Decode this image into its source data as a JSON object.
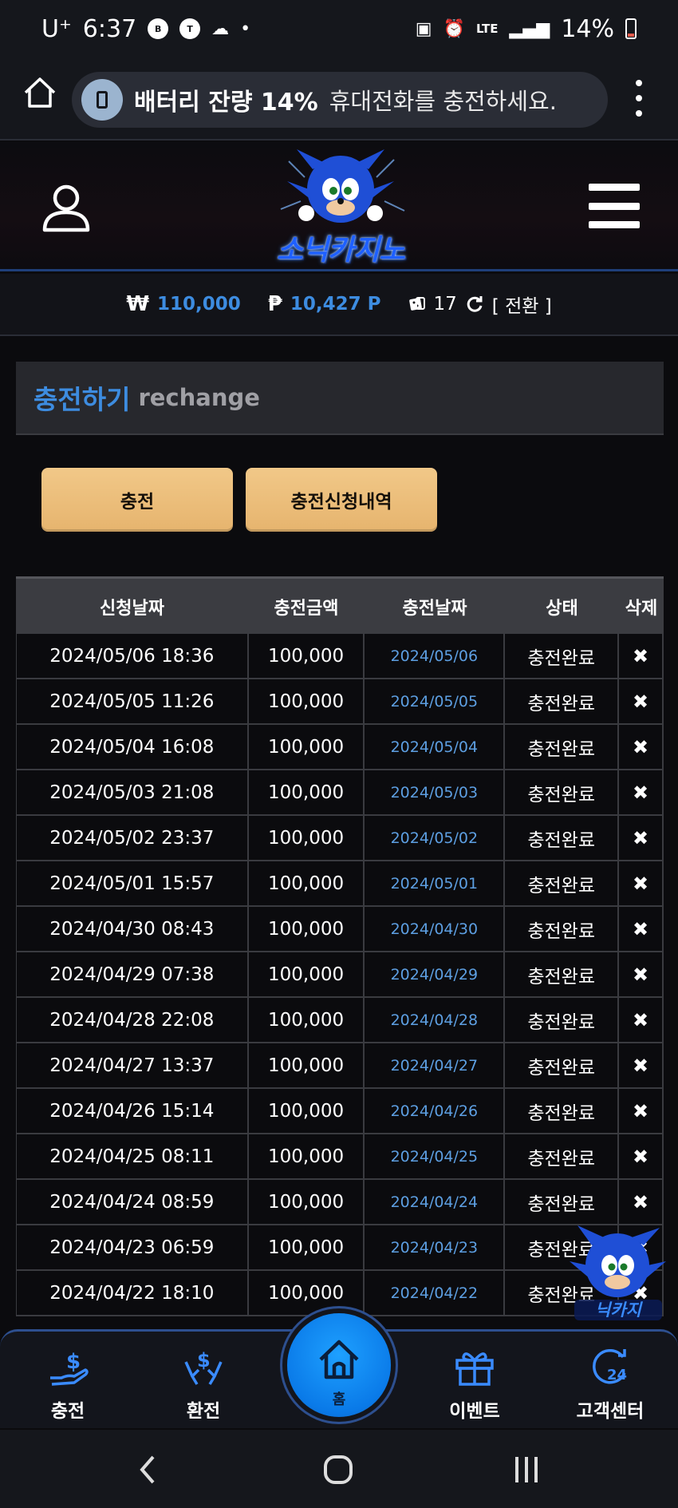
{
  "status_bar": {
    "carrier": "U⁺",
    "time": "6:37",
    "network": "LTE",
    "battery": "14%"
  },
  "browser": {
    "toast_title": "배터리 잔량 14%",
    "toast_message": "휴대전화를 충전하세요."
  },
  "header": {
    "logo_text": "소닉카지노"
  },
  "balance": {
    "won_symbol": "₩",
    "money": "110,000",
    "point_symbol": "₱",
    "points": "10,427 P",
    "count": "17",
    "convert_label": "[ 전환 ]"
  },
  "section": {
    "title": "충전하기",
    "subtitle": "rechange"
  },
  "buttons": {
    "charge": "충전",
    "history": "충전신청내역"
  },
  "table": {
    "headers": [
      "신청날짜",
      "충전금액",
      "충전날짜",
      "상태",
      "삭제"
    ],
    "delete_symbol": "✖",
    "rows": [
      {
        "req": "2024/05/06 18:36",
        "amount": "100,000",
        "date": "2024/05/06",
        "status": "충전완료"
      },
      {
        "req": "2024/05/05 11:26",
        "amount": "100,000",
        "date": "2024/05/05",
        "status": "충전완료"
      },
      {
        "req": "2024/05/04 16:08",
        "amount": "100,000",
        "date": "2024/05/04",
        "status": "충전완료"
      },
      {
        "req": "2024/05/03 21:08",
        "amount": "100,000",
        "date": "2024/05/03",
        "status": "충전완료"
      },
      {
        "req": "2024/05/02 23:37",
        "amount": "100,000",
        "date": "2024/05/02",
        "status": "충전완료"
      },
      {
        "req": "2024/05/01 15:57",
        "amount": "100,000",
        "date": "2024/05/01",
        "status": "충전완료"
      },
      {
        "req": "2024/04/30 08:43",
        "amount": "100,000",
        "date": "2024/04/30",
        "status": "충전완료"
      },
      {
        "req": "2024/04/29 07:38",
        "amount": "100,000",
        "date": "2024/04/29",
        "status": "충전완료"
      },
      {
        "req": "2024/04/28 22:08",
        "amount": "100,000",
        "date": "2024/04/28",
        "status": "충전완료"
      },
      {
        "req": "2024/04/27 13:37",
        "amount": "100,000",
        "date": "2024/04/27",
        "status": "충전완료"
      },
      {
        "req": "2024/04/26 15:14",
        "amount": "100,000",
        "date": "2024/04/26",
        "status": "충전완료"
      },
      {
        "req": "2024/04/25 08:11",
        "amount": "100,000",
        "date": "2024/04/25",
        "status": "충전완료"
      },
      {
        "req": "2024/04/24 08:59",
        "amount": "100,000",
        "date": "2024/04/24",
        "status": "충전완료"
      },
      {
        "req": "2024/04/23 06:59",
        "amount": "100,000",
        "date": "2024/04/23",
        "status": "충전완료"
      },
      {
        "req": "2024/04/22 18:10",
        "amount": "100,000",
        "date": "2024/04/22",
        "status": "충전완료"
      }
    ]
  },
  "bottom_nav": {
    "charge": "충전",
    "exchange": "환전",
    "home": "홈",
    "event": "이벤트",
    "support": "고객센터"
  },
  "colors": {
    "accent_blue": "#3d8ce0",
    "button_gold": "#e6b46e",
    "home_fab": "#0a7ae8"
  }
}
